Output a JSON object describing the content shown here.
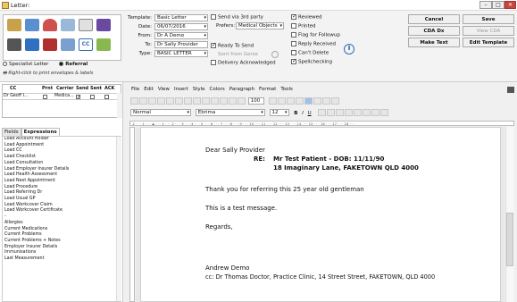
{
  "window": {
    "title": "Letter:"
  },
  "toolbar_icons": [
    "address-card-icon",
    "envelope-icon",
    "person-red-icon",
    "person-icon",
    "document-icon",
    "pen-icon",
    "printer-icon",
    "scanner-icon",
    "book-icon",
    "notepad-icon",
    "cc-icon",
    "copy-icon"
  ],
  "recipient": {
    "specialist_label": "Specialist Letter",
    "referral_label": "Referral",
    "hint": "Right-click to print envelopes & labels"
  },
  "grid": {
    "headers": [
      "CC",
      "Prnt",
      "Carrier",
      "Send",
      "Sent",
      "ACK"
    ],
    "row": [
      "Dr Geoff I...",
      "",
      "Medica...",
      "",
      "",
      ""
    ]
  },
  "form": {
    "template_label": "Template:",
    "template_value": "Basic Letter",
    "date_label": "Date:",
    "date_value": "06/07/2016",
    "from_label": "From:",
    "from_value": "Dr A Demo",
    "to_label": "To:",
    "to_value": "Dr Sally Provider",
    "type_label": "Type:",
    "type_value": "BASIC LETTER",
    "send_3rd_party": "Send via 3rd party",
    "prefers_label": "Prefers:",
    "prefers_value": "Medical Objects",
    "ready_to_send": "Ready To Send",
    "sent_from": "Sent from Genie",
    "delivery_ack": "Delivery Acknowledged"
  },
  "status_checks": [
    {
      "label": "Reviewed",
      "checked": true
    },
    {
      "label": "Printed",
      "checked": false
    },
    {
      "label": "Flag for Followup",
      "checked": false
    },
    {
      "label": "Reply Received",
      "checked": false
    },
    {
      "label": "Can't Delete",
      "checked": false
    },
    {
      "label": "Spellchecking",
      "checked": true
    }
  ],
  "buttons": {
    "cancel": "Cancel",
    "save": "Save",
    "cda_dx": "CDA Dx",
    "view_cda": "View CDA",
    "make_text": "Make Text",
    "edit_template": "Edit Template"
  },
  "tabs": {
    "fields": "Fields",
    "expressions": "Expressions"
  },
  "field_items": [
    "Load Account Holder",
    "Load Appointment",
    "Load CC",
    "Load Checklist",
    "Load Consultation",
    "Load Employer Insurer Details",
    "Load Health Assessment",
    "Load Next Appointment",
    "Load Procedure",
    "Load Referring Dr",
    "Load Usual GP",
    "Load Workcover Claim",
    "Load Workcover Certificate",
    "-",
    "Allergies",
    "Current Medications",
    "Current Problems",
    "Current Problems + Notes",
    "Employer Insurer Details",
    "Immunisations",
    "Last Measurement"
  ],
  "menu": [
    "File",
    "Edit",
    "View",
    "Insert",
    "Style",
    "Colors",
    "Paragraph",
    "Format",
    "Tools"
  ],
  "format": {
    "style": "Normal",
    "font": "Ebrima",
    "size": "12",
    "zoom": "100"
  },
  "letter": {
    "salutation": "Dear Sally Provider",
    "re_label": "RE:",
    "re_line1": "Mr Test Patient - DOB: 11/11/90",
    "re_line2": "18 Imaginary Lane, FAKETOWN QLD 4000",
    "para1": "Thank you for referring this 25 year old gentleman",
    "para2": "This is a test message.",
    "closing": "Regards,",
    "signature": "Andrew Demo",
    "cc": "cc: Dr Thomas Doctor, Practice Clinic, 14 Street Street, FAKETOWN, QLD 4000"
  },
  "colors": {
    "accent": "#2f6fb6",
    "close": "#c9463d"
  }
}
